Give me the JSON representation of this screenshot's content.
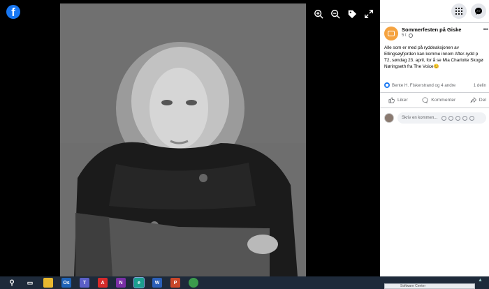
{
  "viewer": {
    "logo_letter": "f",
    "tools": [
      {
        "name": "zoom-in-icon"
      },
      {
        "name": "zoom-out-icon"
      },
      {
        "name": "tag-icon"
      },
      {
        "name": "fullscreen-icon"
      }
    ]
  },
  "topbar": {
    "menu_icon": "grid-menu-icon",
    "messenger_icon": "messenger-icon"
  },
  "post": {
    "page_name": "Sommerfesten på Giske",
    "time": "5 t",
    "text_lines": [
      "Alle som er med på ryddeaksjonen av",
      "Ellingsøyfjorden kan komme innom After-rydd p",
      "T2, søndag 23. april, for å se Mia Charlotte Skogø",
      "Nøringseth fra The Voice😊"
    ],
    "reactions_text": "Bente H. Fiskerstrand og 4 andre",
    "shares_text": "1 delin",
    "actions": {
      "like": "Liker",
      "comment": "Kommenter",
      "share": "Del"
    },
    "comment_placeholder": "Skriv en kommen..."
  },
  "taskbar": {
    "apps": [
      {
        "name": "file-explorer-icon",
        "label": "",
        "color": "#e8b830"
      },
      {
        "name": "outlook-icon",
        "label": "Os",
        "color": "#1f63b8"
      },
      {
        "name": "teams-icon",
        "label": "T",
        "color": "#5b5fc7"
      },
      {
        "name": "acrobat-icon",
        "label": "A",
        "color": "#d62a2a"
      },
      {
        "name": "onenote-icon",
        "label": "N",
        "color": "#7a2fa5"
      },
      {
        "name": "edge-icon",
        "label": "e",
        "color": "#1b9e8f"
      },
      {
        "name": "word-icon",
        "label": "W",
        "color": "#2b5fb8"
      },
      {
        "name": "powerpoint-icon",
        "label": "P",
        "color": "#c9472a"
      },
      {
        "name": "chrome-icon",
        "label": "",
        "color": "#3b9b4c"
      }
    ],
    "notification_text": "Software Center"
  },
  "colors": {
    "facebook_blue": "#1877f2",
    "page_avatar": "#f5a340",
    "taskbar": "#1e2a3a"
  }
}
